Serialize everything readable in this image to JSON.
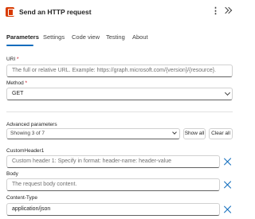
{
  "header": {
    "title": "Send an HTTP request",
    "icon": "office-icon",
    "accent": "#d83b01"
  },
  "tabs": [
    {
      "label": "Parameters",
      "active": true
    },
    {
      "label": "Settings",
      "active": false
    },
    {
      "label": "Code view",
      "active": false
    },
    {
      "label": "Testing",
      "active": false
    },
    {
      "label": "About",
      "active": false
    }
  ],
  "uri": {
    "label": "URI",
    "required_mark": "*",
    "placeholder": "The full or relative URL. Example: https://graph.microsoft.com/{version}/{resource}."
  },
  "method": {
    "label": "Method",
    "required_mark": "*",
    "value": "GET"
  },
  "advanced": {
    "label": "Advanced parameters",
    "selector_text": "Showing 3 of 7",
    "show_all_label": "Show all",
    "clear_all_label": "Clear all"
  },
  "custom_header": {
    "label": "CustomHeader1",
    "placeholder": "Custom header 1: Specify in format: header-name: header-value"
  },
  "body_field": {
    "label": "Body",
    "placeholder": "The request body content."
  },
  "content_type": {
    "label": "Content-Type",
    "value": "application/json"
  },
  "colors": {
    "link_blue": "#0f6cbd",
    "required_red": "#c50f1f"
  }
}
